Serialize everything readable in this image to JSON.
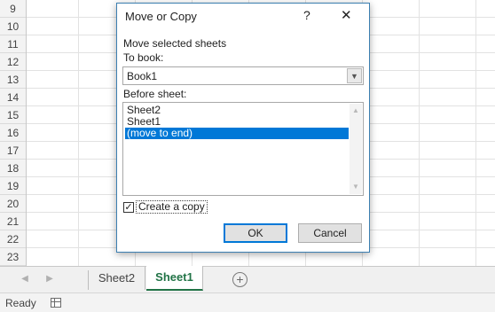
{
  "grid": {
    "row_numbers": [
      "9",
      "10",
      "11",
      "12",
      "13",
      "14",
      "15",
      "16",
      "17",
      "18",
      "19",
      "20",
      "21",
      "22",
      "23"
    ]
  },
  "sheet_tabs": {
    "tabs": [
      {
        "label": "Sheet2",
        "active": false
      },
      {
        "label": "Sheet1",
        "active": true
      }
    ],
    "add_label": "+"
  },
  "status_bar": {
    "status": "Ready"
  },
  "dialog": {
    "title": "Move or Copy",
    "help": "?",
    "close": "✕",
    "instruction": "Move selected sheets",
    "to_book_label": "To book:",
    "to_book_value": "Book1",
    "before_sheet_label": "Before sheet:",
    "sheets": [
      "Sheet2",
      "Sheet1",
      "(move to end)"
    ],
    "selected_index": 2,
    "create_copy_label": "Create a copy",
    "create_copy_checked": true,
    "ok_label": "OK",
    "cancel_label": "Cancel"
  },
  "colors": {
    "selection": "#0078d7",
    "active_tab_text": "#217346",
    "dialog_border": "#3c7fb1"
  }
}
